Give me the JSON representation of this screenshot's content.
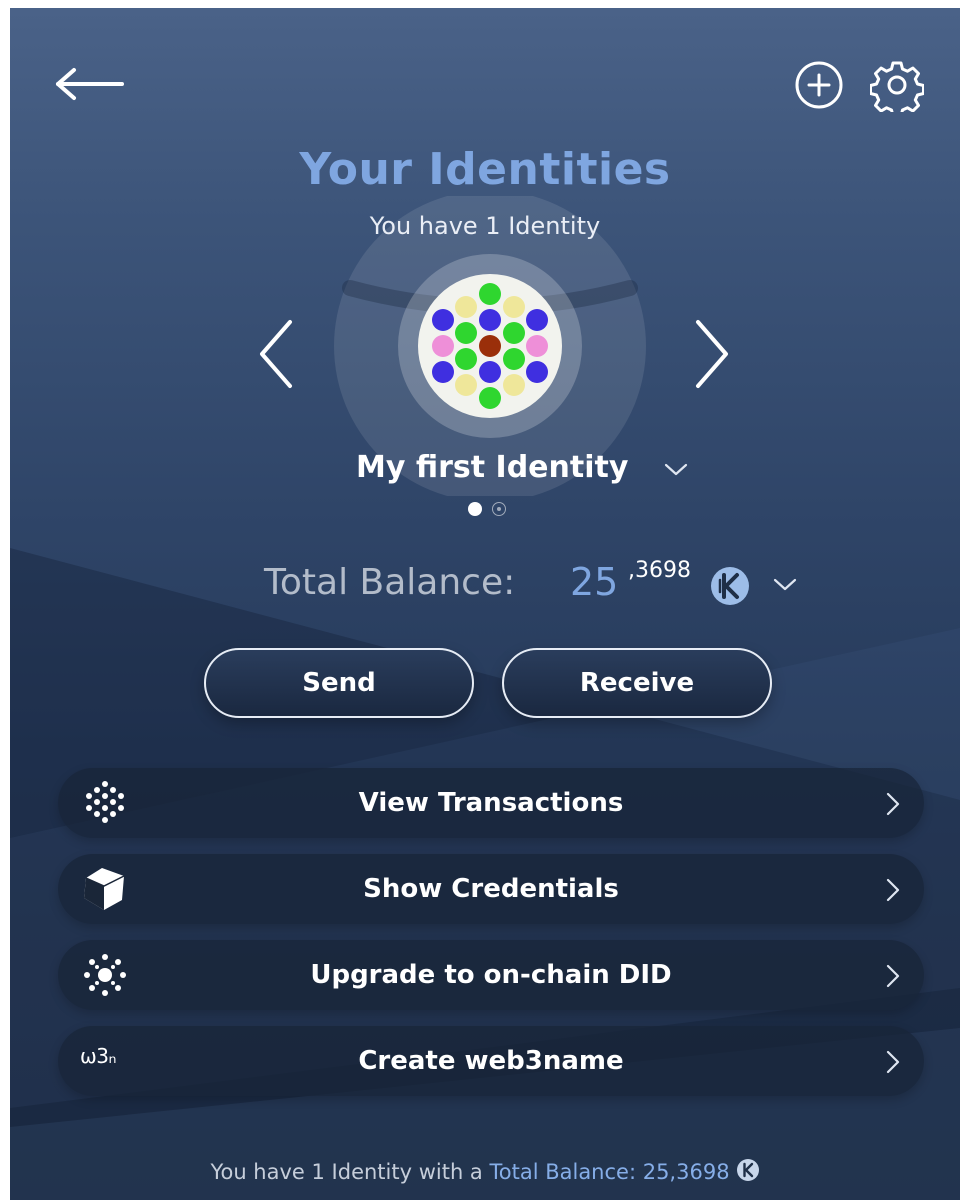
{
  "header": {
    "back_icon": "back-arrow-icon",
    "add_icon": "add-circle-icon",
    "settings_icon": "gear-icon"
  },
  "page": {
    "title": "Your Identities",
    "subtitle": "You have 1 Identity"
  },
  "identity": {
    "name": "My first Identity",
    "page_count": 2,
    "active_page": 1,
    "avatar_colors": {
      "green": "#2fd62f",
      "yellow": "#efe79a",
      "blue": "#3f2fe0",
      "pink": "#ee8fd8",
      "brown": "#9a2f0a"
    }
  },
  "balance": {
    "label": "Total Balance:",
    "integer": "25",
    "decimal": ",3698",
    "currency_icon": "kilt-coin-icon"
  },
  "actions": {
    "send_label": "Send",
    "receive_label": "Receive"
  },
  "menu": {
    "items": [
      {
        "label": "View Transactions",
        "icon": "transactions-icon"
      },
      {
        "label": "Show Credentials",
        "icon": "cube-icon"
      },
      {
        "label": "Upgrade to on-chain DID",
        "icon": "sparkle-icon"
      },
      {
        "label": "Create web3name",
        "icon": "w3n-icon",
        "icon_text": "ω3ₙ"
      }
    ]
  },
  "footer": {
    "prefix": "You have 1 Identity with a ",
    "link": "Total Balance: 25,3698"
  },
  "colors": {
    "accent": "#7fa6e0",
    "background_top": "#4a6288",
    "background_bottom": "#1f2f47"
  }
}
